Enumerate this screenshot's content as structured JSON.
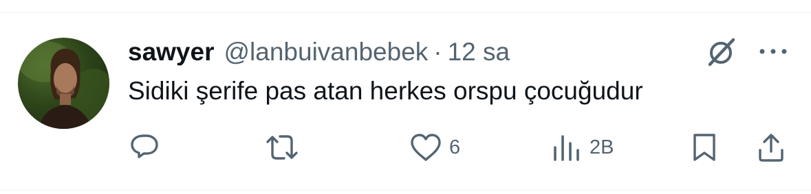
{
  "tweet": {
    "author_name": "sawyer",
    "author_handle": "@lanbuivanbebek",
    "separator": "·",
    "timestamp": "12 sa",
    "text": "Sidiki şerife pas atan herkes orspu çocuğudur"
  },
  "actions": {
    "reply_icon": "reply-icon",
    "retweet_icon": "retweet-icon",
    "like_icon": "heart-icon",
    "like_count": "6",
    "views_icon": "views-icon",
    "views_count": "2B",
    "bookmark_icon": "bookmark-icon",
    "share_icon": "share-icon"
  },
  "header_icons": [
    "grok-icon",
    "more-icon"
  ],
  "colors": {
    "text_primary": "#0f1419",
    "text_secondary": "#536471",
    "divider": "#eff3f4",
    "background": "#ffffff"
  }
}
